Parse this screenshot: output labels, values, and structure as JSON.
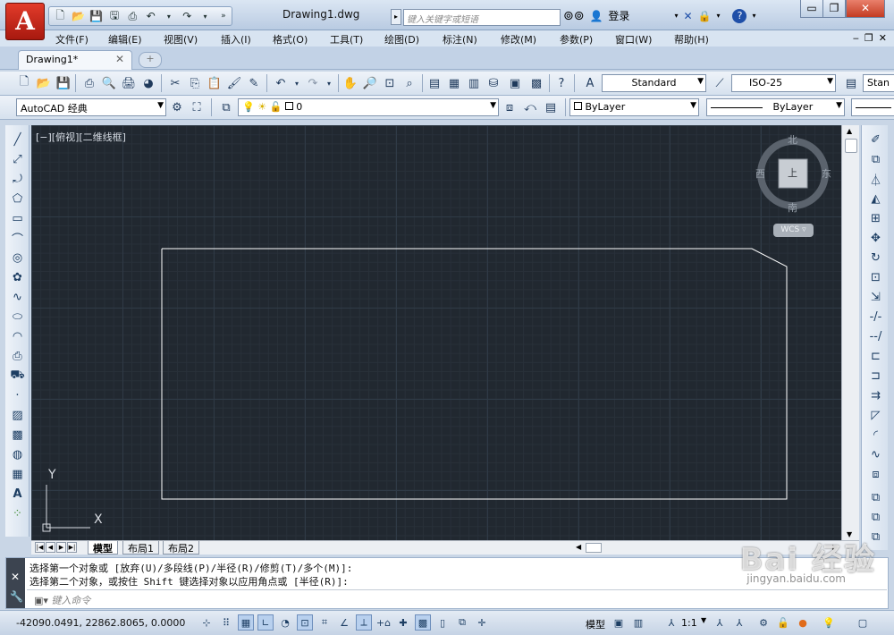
{
  "title_bar": {
    "app_logo": "A",
    "document_title": "Drawing1.dwg",
    "search_placeholder": "键入关键字或短语",
    "login_label": "登录",
    "help_label": "?",
    "min_label": "▭",
    "restore_label": "❐",
    "close_label": "✕"
  },
  "quick_access": [
    "new-icon",
    "open-icon",
    "save-icon",
    "saveas-icon",
    "print-icon",
    "undo-icon",
    "redo-icon"
  ],
  "menu": {
    "items": [
      "文件(F)",
      "编辑(E)",
      "视图(V)",
      "插入(I)",
      "格式(O)",
      "工具(T)",
      "绘图(D)",
      "标注(N)",
      "修改(M)",
      "参数(P)",
      "窗口(W)",
      "帮助(H)"
    ],
    "mdi_min": "‒",
    "mdi_restore": "❐",
    "mdi_close": "✕"
  },
  "doc_tab": {
    "label": "Drawing1*",
    "close": "✕"
  },
  "styles": {
    "text_style": "Standard",
    "dim_style": "ISO-25",
    "table_style": "Stan"
  },
  "layers": {
    "workspace": "AutoCAD 经典",
    "current_layer": "0",
    "color": "ByLayer",
    "linetype": "ByLayer"
  },
  "viewport": {
    "label": "[−][俯视][二维线框]",
    "compass": {
      "north": "北",
      "south": "南",
      "east": "东",
      "west": "西",
      "center": "上"
    },
    "wcs": "WCS",
    "ucs_x": "X",
    "ucs_y": "Y"
  },
  "layout_tabs": [
    "模型",
    "布局1",
    "布局2"
  ],
  "command": {
    "history": [
      "选择第一个对象或 [放弃(U)/多段线(P)/半径(R)/修剪(T)/多个(M)]:",
      "选择第二个对象，或按住 Shift 键选择对象以应用角点或 [半径(R)]:"
    ],
    "input_placeholder": "键入命令"
  },
  "status": {
    "coordinates": "-42090.0491, 22862.8065, 0.0000",
    "model_label": "模型",
    "scale": "1:1"
  },
  "watermark": {
    "main": "Bai 经验",
    "sub": "jingyan.baidu.com"
  },
  "colors": {
    "canvas_bg": "#212830",
    "drawing_line": "#ffffff",
    "titlebar": "#c7d6ea"
  }
}
